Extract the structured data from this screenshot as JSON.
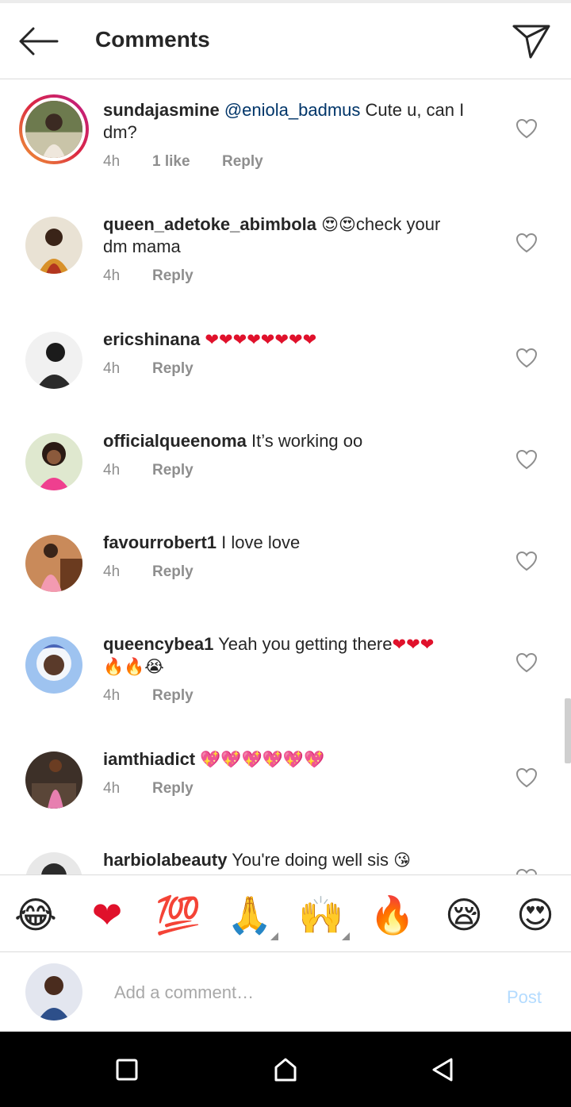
{
  "header": {
    "title": "Comments"
  },
  "comments": [
    {
      "username": "sundajasmine",
      "mention": "@eniola_badmus",
      "text_line1": " Cute u, can I",
      "text_line2": "dm?",
      "time": "4h",
      "likes": "1 like",
      "reply": "Reply"
    },
    {
      "username": "queen_adetoke_abimbola",
      "emoji": "😍😍",
      "text_line1": "check your",
      "text_line2": "dm mama",
      "time": "4h",
      "reply": "Reply"
    },
    {
      "username": "ericshinana",
      "emoji": "❤❤❤❤❤❤❤❤",
      "time": "4h",
      "reply": "Reply"
    },
    {
      "username": "officialqueenoma",
      "text_line1": " It’s working oo",
      "time": "4h",
      "reply": "Reply"
    },
    {
      "username": "favourrobert1",
      "text_line1": " I love love",
      "time": "4h",
      "reply": "Reply"
    },
    {
      "username": "queencybea1",
      "text_line1": " Yeah you getting there",
      "emoji": "❤❤❤",
      "emoji_line2": "🔥🔥😭",
      "time": "4h",
      "reply": "Reply"
    },
    {
      "username": "iamthiadict",
      "emoji": "💖💖💖💖💖💖",
      "time": "4h",
      "reply": "Reply"
    },
    {
      "username": "harbiolabeauty",
      "text_line1": " You're doing well sis ",
      "emoji": "😘"
    }
  ],
  "emoji_bar": [
    "😂",
    "❤",
    "💯",
    "🙏",
    "🙌",
    "🔥",
    "😪",
    "😍"
  ],
  "composer": {
    "placeholder": "Add a comment…",
    "post_label": "Post"
  },
  "colors": {
    "link_blue": "#003569",
    "post_disabled": "#b3dbff",
    "heart_red": "#e0112b",
    "meta_gray": "#8e8e8e"
  }
}
